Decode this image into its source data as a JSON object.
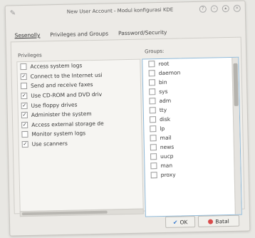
{
  "window": {
    "title": "New User Account - Modul konfigurasi KDE"
  },
  "tabs": [
    {
      "label": "Sesenolly",
      "active": true
    },
    {
      "label": "Privileges and Groups",
      "active": false
    },
    {
      "label": "Password/Security",
      "active": false
    }
  ],
  "privileges": {
    "label": "Privileges",
    "items": [
      {
        "label": "Access system logs",
        "checked": false
      },
      {
        "label": "Connect to the Internet usi",
        "checked": true
      },
      {
        "label": "Send and receive faxes",
        "checked": false
      },
      {
        "label": "Use CD-ROM and DVD driv",
        "checked": true
      },
      {
        "label": "Use floppy drives",
        "checked": true
      },
      {
        "label": "Administer the system",
        "checked": true
      },
      {
        "label": "Access external storage de",
        "checked": true
      },
      {
        "label": "Monitor system logs",
        "checked": false
      },
      {
        "label": "Use scanners",
        "checked": true
      }
    ]
  },
  "groups": {
    "label": "Groups:",
    "items": [
      "root",
      "daemon",
      "bin",
      "sys",
      "adm",
      "tty",
      "disk",
      "lp",
      "mail",
      "news",
      "uucp",
      "man",
      "proxy"
    ]
  },
  "buttons": {
    "ok": "OK",
    "cancel": "Batal"
  },
  "colors": {
    "focus_border": "#8fb9d8",
    "cancel_icon": "#d94b4b",
    "ok_icon": "#3f7fcf"
  }
}
